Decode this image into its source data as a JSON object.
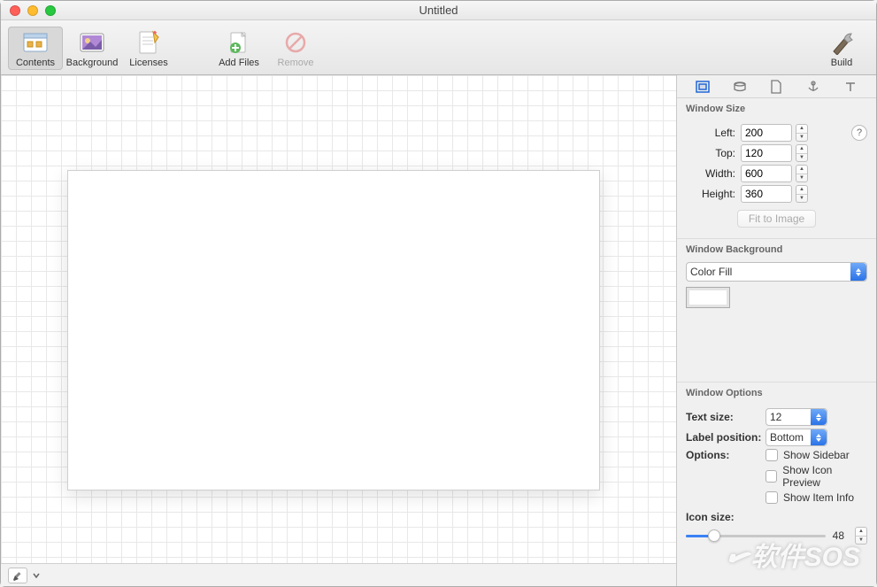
{
  "window": {
    "title": "Untitled"
  },
  "toolbar": {
    "contents": "Contents",
    "background": "Background",
    "licenses": "Licenses",
    "addFiles": "Add Files",
    "remove": "Remove",
    "build": "Build"
  },
  "inspector": {
    "tabs": [
      "layout",
      "disk",
      "page",
      "anchor",
      "text"
    ],
    "windowSize": {
      "title": "Window Size",
      "leftLabel": "Left:",
      "left": "200",
      "topLabel": "Top:",
      "top": "120",
      "widthLabel": "Width:",
      "width": "600",
      "heightLabel": "Height:",
      "height": "360",
      "fit": "Fit to Image",
      "help": "?"
    },
    "windowBackground": {
      "title": "Window Background",
      "mode": "Color Fill"
    },
    "windowOptions": {
      "title": "Window Options",
      "textSizeLabel": "Text size:",
      "textSize": "12",
      "labelPositionLabel": "Label position:",
      "labelPosition": "Bottom",
      "optionsLabel": "Options:",
      "showSidebar": "Show Sidebar",
      "showIconPreview": "Show Icon Preview",
      "showItemInfo": "Show Item Info",
      "iconSizeLabel": "Icon size:",
      "iconSize": "48"
    }
  },
  "watermark": "软件SOS"
}
